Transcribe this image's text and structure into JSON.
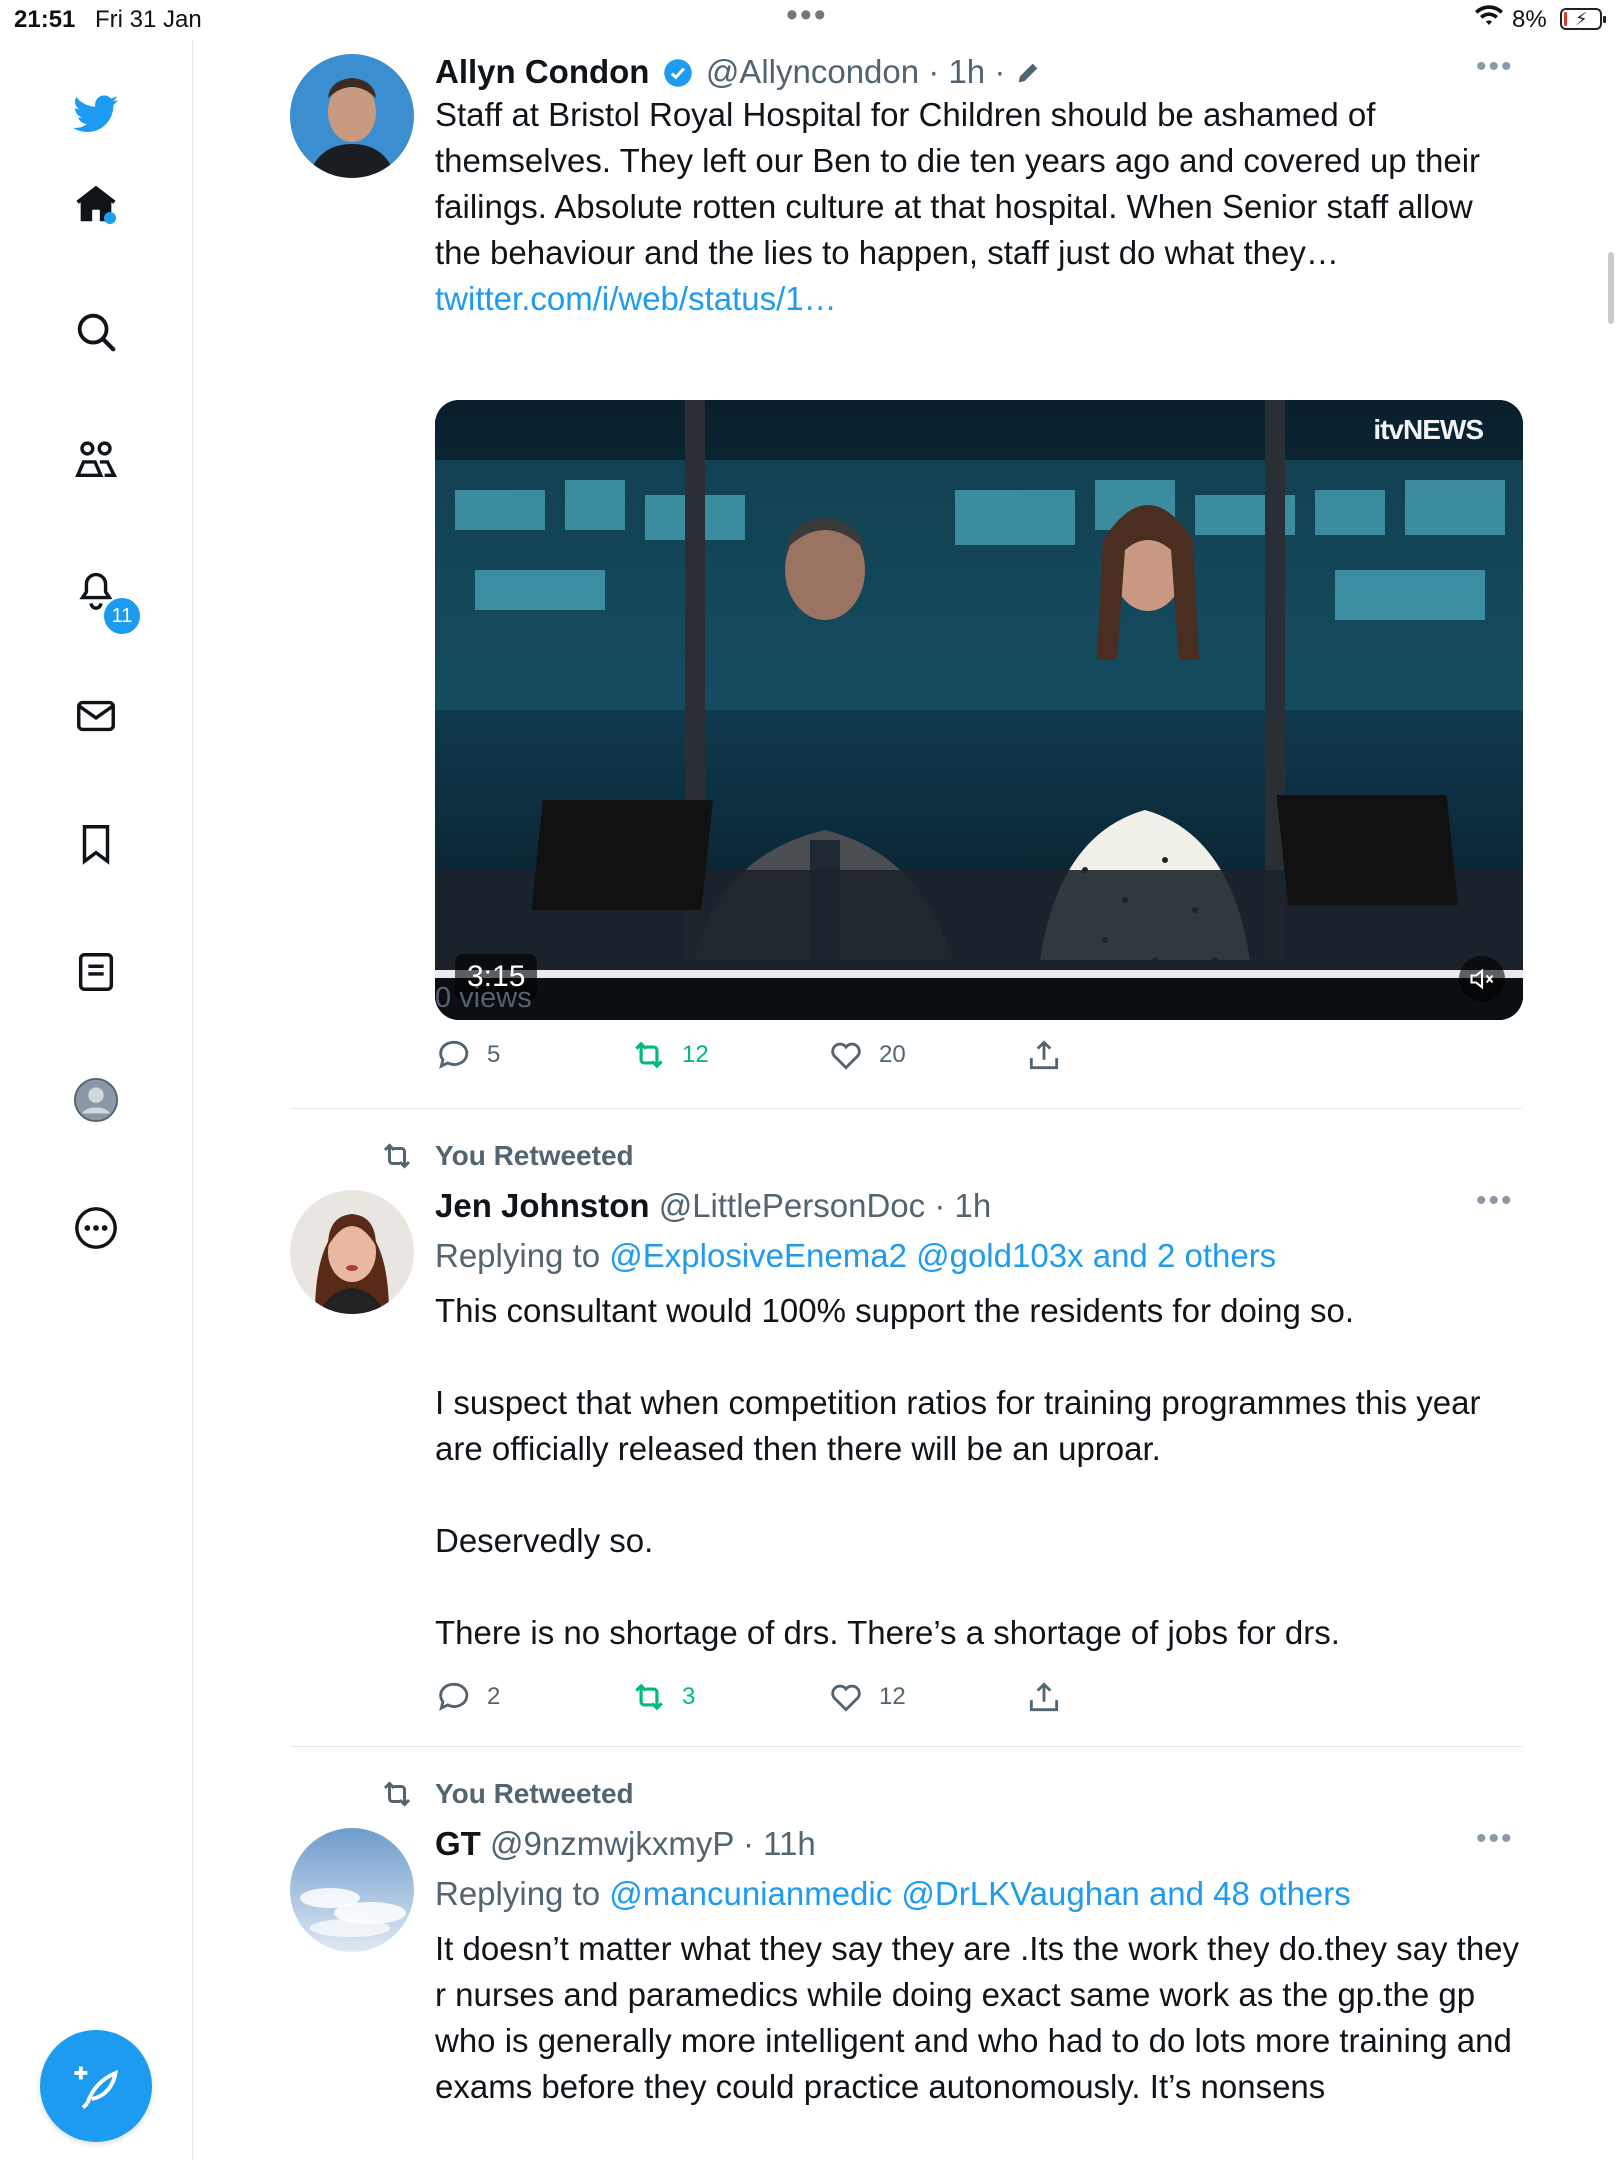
{
  "status_bar": {
    "time": "21:51",
    "date": "Fri 31 Jan",
    "battery": "8%"
  },
  "sidebar": {
    "notifications_badge": "11",
    "items": [
      {
        "name": "home"
      },
      {
        "name": "explore"
      },
      {
        "name": "communities"
      },
      {
        "name": "notifications"
      },
      {
        "name": "messages"
      },
      {
        "name": "bookmarks"
      },
      {
        "name": "lists"
      },
      {
        "name": "profile"
      },
      {
        "name": "more"
      }
    ]
  },
  "tweets": [
    {
      "name": "Allyn Condon",
      "handle": "@Allyncondon",
      "time": "· 1h ·",
      "text": "Staff at Bristol Royal Hospital for Children should be ashamed of themselves. They left our Ben to die ten years ago and covered up their failings. Absolute rotten culture at that hospital. When Senior staff allow the behaviour and the lies to happen, staff just do what they…",
      "link": "twitter.com/i/web/status/1…",
      "media": {
        "duration": "3:15",
        "logo": "itvNEWS"
      },
      "views": "0 views",
      "replies": "5",
      "retweets": "12",
      "likes": "20"
    },
    {
      "context": "You Retweeted",
      "name": "Jen Johnston",
      "handle": "@LittlePersonDoc",
      "time": "· 1h",
      "replying_prefix": "Replying to",
      "replying_mentions": "@ExplosiveEnema2 @gold103x and 2 others",
      "text": "This consultant would 100% support the residents for doing so.\n\nI suspect that when competition ratios for training programmes this year are officially released then there will be an uproar.\n\nDeservedly so.\n\nThere is no shortage of drs. There’s a shortage of jobs for drs.",
      "replies": "2",
      "retweets": "3",
      "likes": "12"
    },
    {
      "context": "You Retweeted",
      "name": "GT",
      "handle": "@9nzmwjkxmyP",
      "time": "· 11h",
      "replying_prefix": "Replying to",
      "replying_mentions": "@mancunianmedic @DrLKVaughan and 48 others",
      "text": "It doesn’t matter what they say they are .Its the work they do.they say they r nurses and paramedics while doing exact same work as the gp.the gp who is generally more intelligent and who had to do lots more training and exams before they could practice autonomously. It’s nonsens"
    }
  ],
  "colors": {
    "accent": "#1d9bf0",
    "retweet": "#00ba7c",
    "muted": "#536471"
  }
}
